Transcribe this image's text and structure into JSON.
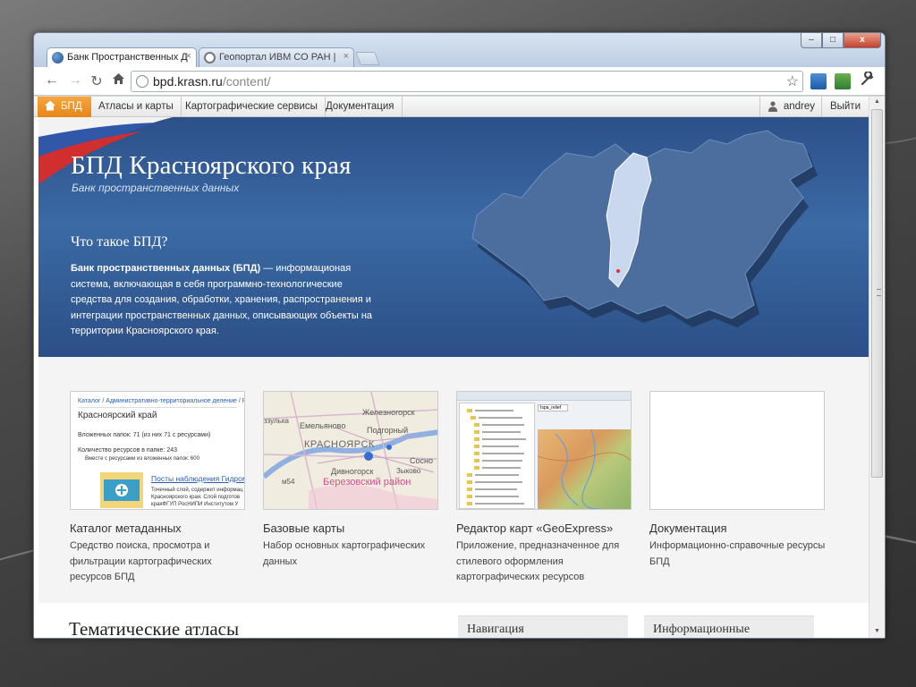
{
  "browser": {
    "tabs": [
      {
        "title": "Банк Пространственных Д",
        "active": true
      },
      {
        "title": "Геопортал ИВМ СО РАН |",
        "active": false
      }
    ],
    "close_glyph": "×",
    "window_buttons": {
      "minimize": "–",
      "maximize": "□",
      "close": "x"
    },
    "url_host": "bpd.krasn.ru",
    "url_path": "/content/"
  },
  "site_nav": {
    "home": "БПД",
    "items": [
      "Атласы и карты",
      "Картографические сервисы",
      "Документация"
    ],
    "user": "andrey",
    "logout": "Выйти"
  },
  "hero": {
    "title": "БПД Красноярского края",
    "subtitle": "Банк пространственных данных",
    "question": "Что такое БПД?",
    "desc_bold": "Банк пространственных данных (БПД)",
    "desc_rest": " — информационая система, включающая в себя программно-технологические средства для создания, обработки, хранения, распространения и интеграции пространственных данных, описывающих объекты на территории Красноярского края."
  },
  "cards": [
    {
      "title": "Каталог метаданных",
      "desc": "Средство поиска, просмотра и фильтрации картографических ресурсов БПД",
      "thumb": {
        "breadcrumb": "Каталог / Административно-территориальное деление / Росси",
        "heading": "Красноярский край",
        "line1": "Вложенных папок: 71 (из них 71 с ресурсами)",
        "line2": "Количество ресурсов в папке: 243",
        "line3": "Вместе с ресурсами из вложенных папок: 600",
        "link": "Посты наблюдения Гидроме",
        "small1": "Точечный слой, содержит информац",
        "small2": "Красноярского края. Слой подготов",
        "small3": "краяФГУП РосНИПИ Институтом У"
      }
    },
    {
      "title": "Базовые карты",
      "desc": "Набор основных картографических данных",
      "thumb": {
        "l1": "Железногорск",
        "l2": "Емельяново",
        "l3": "Подгорный",
        "l4": "КРАСНОЯРСК",
        "l5": "Дивногорск",
        "l6": "Березовский район",
        "l7": "Сосно",
        "l8": "Зыково",
        "l9": "ззулька",
        "l10": "м54"
      }
    },
    {
      "title": "Редактор карт «GeoExpress»",
      "desc": "Приложение, предназначенное для стилевого оформления картографических ресурсов",
      "thumb": {
        "tab": "Ispa_relief"
      }
    },
    {
      "title": "Документация",
      "desc": "Информационно-справочные ресурсы БПД"
    }
  ],
  "bottom": {
    "atlas_heading": "Тематические атласы",
    "panel_nav": "Навигация",
    "panel_info": "Информационные"
  },
  "colors": {
    "hero_blue": "#3b6aa5",
    "nav_orange": "#e6861a"
  }
}
